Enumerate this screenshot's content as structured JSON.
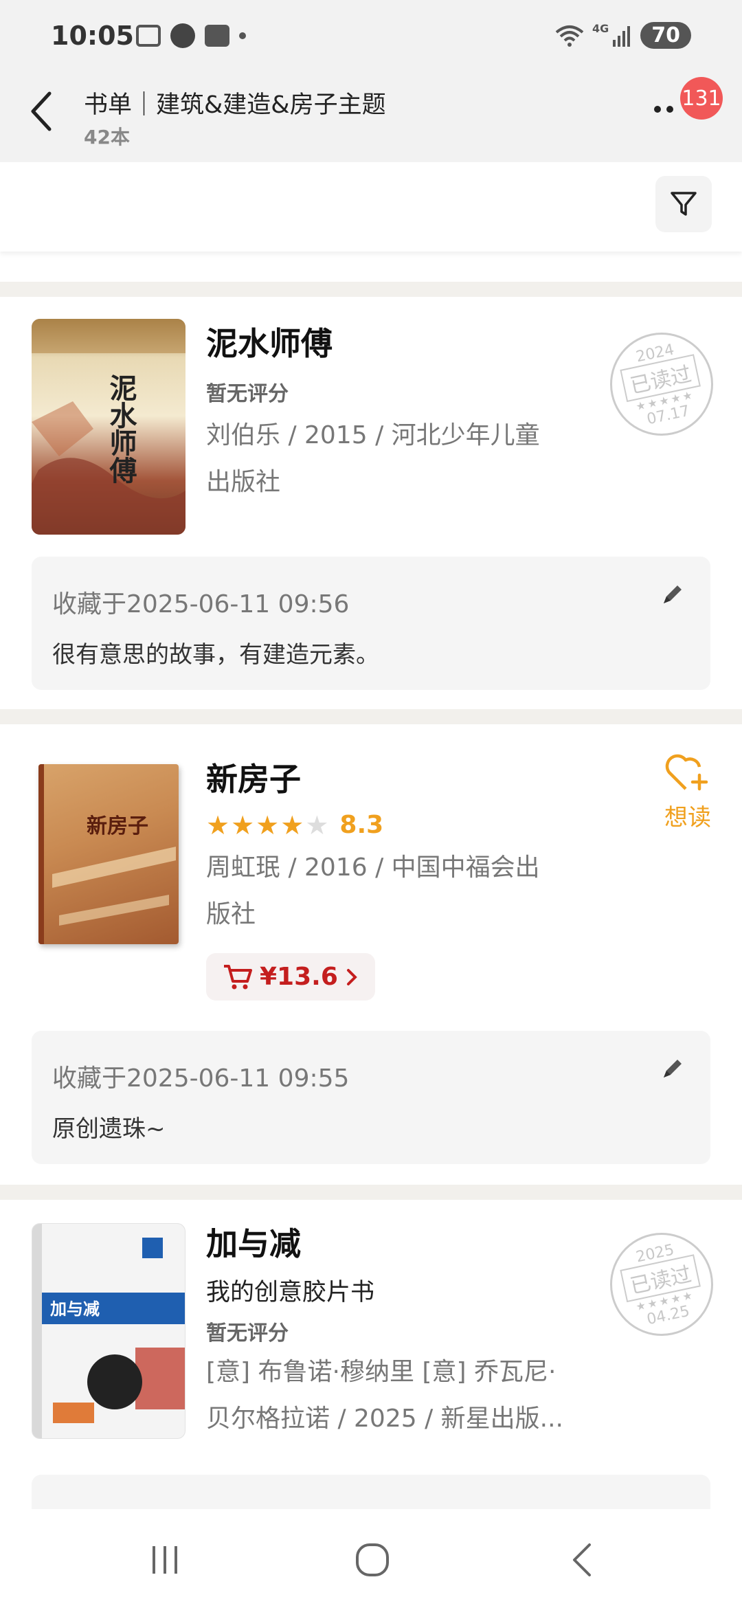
{
  "status_bar": {
    "time": "10:05",
    "network": "4G",
    "battery": "70"
  },
  "header": {
    "title": "书单｜建筑&建造&房子主题",
    "subtitle": "42本",
    "notification_count": "131"
  },
  "colors": {
    "accent_orange": "#f0a01e",
    "price_red": "#c41e1e",
    "star_empty": "#dddddd"
  },
  "books": [
    {
      "title": "泥水师傅",
      "rating_text": "暂无评分",
      "meta_line1": "刘伯乐 / 2015 / 河北少年儿童",
      "meta_line2": "出版社",
      "read_stamp": {
        "year": "2024",
        "label": "已读过",
        "date": "07.17"
      },
      "note": {
        "date": "收藏于2025-06-11 09:56",
        "text": "很有意思的故事，有建造元素。"
      }
    },
    {
      "title": "新房子",
      "rating": {
        "stars": 4,
        "max": 5,
        "score": "8.3"
      },
      "meta_line1": "周虹珉 / 2016 / 中国中福会出",
      "meta_line2": "版社",
      "price": "¥13.6",
      "want_label": "想读",
      "note": {
        "date": "收藏于2025-06-11 09:55",
        "text": "原创遗珠~"
      }
    },
    {
      "title": "加与减",
      "subtitle": "我的创意胶片书",
      "rating_text": "暂无评分",
      "meta_line1": "[意] 布鲁诺·穆纳里 [意] 乔瓦尼·",
      "meta_line2": "贝尔格拉诺 / 2025 / 新星出版...",
      "read_stamp": {
        "year": "2025",
        "label": "已读过",
        "date": "04.25"
      }
    }
  ]
}
